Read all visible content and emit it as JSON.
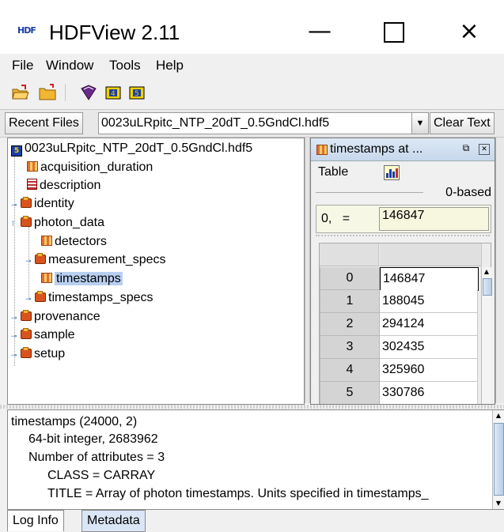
{
  "window": {
    "logo": "HDF",
    "title": "HDFView 2.11",
    "minimize": "—",
    "close": "×"
  },
  "menu": {
    "file": "File",
    "window": "Window",
    "tools": "Tools",
    "help": "Help"
  },
  "recent": {
    "button_label": "Recent Files",
    "selected_file": "0023uLRpitc_NTP_20dT_0.5GndCl.hdf5",
    "clear_label": "Clear Text"
  },
  "tree": {
    "root": "0023uLRpitc_NTP_20dT_0.5GndCl.hdf5",
    "items": [
      {
        "label": "acquisition_duration",
        "icon": "dataset-icon"
      },
      {
        "label": "description",
        "icon": "text-dataset-icon"
      },
      {
        "label": "identity",
        "icon": "folder-icon"
      },
      {
        "label": "photon_data",
        "icon": "folder-open-icon"
      },
      {
        "label": "detectors",
        "icon": "dataset-icon"
      },
      {
        "label": "measurement_specs",
        "icon": "folder-icon"
      },
      {
        "label": "timestamps",
        "icon": "dataset-icon"
      },
      {
        "label": "timestamps_specs",
        "icon": "folder-icon"
      },
      {
        "label": "provenance",
        "icon": "folder-icon"
      },
      {
        "label": "sample",
        "icon": "folder-icon"
      },
      {
        "label": "setup",
        "icon": "folder-icon"
      }
    ]
  },
  "dataview": {
    "title": "timestamps  at ...",
    "table_menu": "Table",
    "index_base": "0-based",
    "cell_label": "0,",
    "cell_eq": "=",
    "cell_value": "146847",
    "rows": [
      {
        "index": "0",
        "value": "146847"
      },
      {
        "index": "1",
        "value": "188045"
      },
      {
        "index": "2",
        "value": "294124"
      },
      {
        "index": "3",
        "value": "302435"
      },
      {
        "index": "4",
        "value": "325960"
      },
      {
        "index": "5",
        "value": "330786"
      }
    ]
  },
  "info": {
    "line1": "timestamps (24000, 2)",
    "line2": "64-bit integer,    2683962",
    "line3": "Number of attributes = 3",
    "line4": "CLASS = CARRAY",
    "line5": "TITLE = Array of photon timestamps. Units specified in timestamps_"
  },
  "tabs": {
    "log": "Log Info",
    "metadata": "Metadata"
  }
}
